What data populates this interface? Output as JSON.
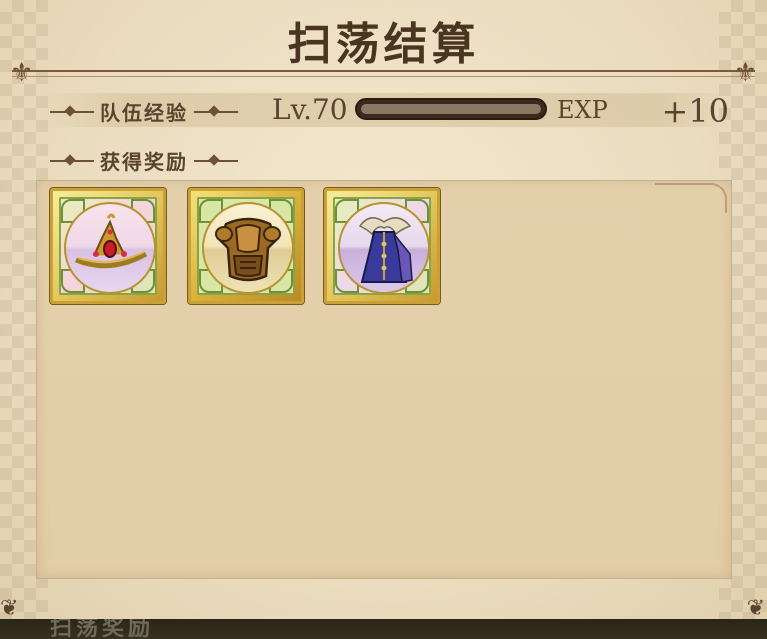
{
  "title": "扫荡结算",
  "exp": {
    "label": "队伍经验",
    "level": "Lv.70",
    "unit": "EXP",
    "gain": "+10",
    "progress": 0.0
  },
  "rewards": {
    "label": "获得奖励",
    "items": [
      {
        "icon": "tiara-icon",
        "rarity_color": "#e3c85a"
      },
      {
        "icon": "armor-icon",
        "rarity_color": "#d9b23a"
      },
      {
        "icon": "robe-icon",
        "rarity_color": "#e3c85a"
      }
    ]
  },
  "footer": {
    "partial_text": "扫荡奖励"
  },
  "colors": {
    "text_primary": "#4a3522",
    "parchment": "#e9dcc0",
    "frame_gold": "#caa03a"
  }
}
